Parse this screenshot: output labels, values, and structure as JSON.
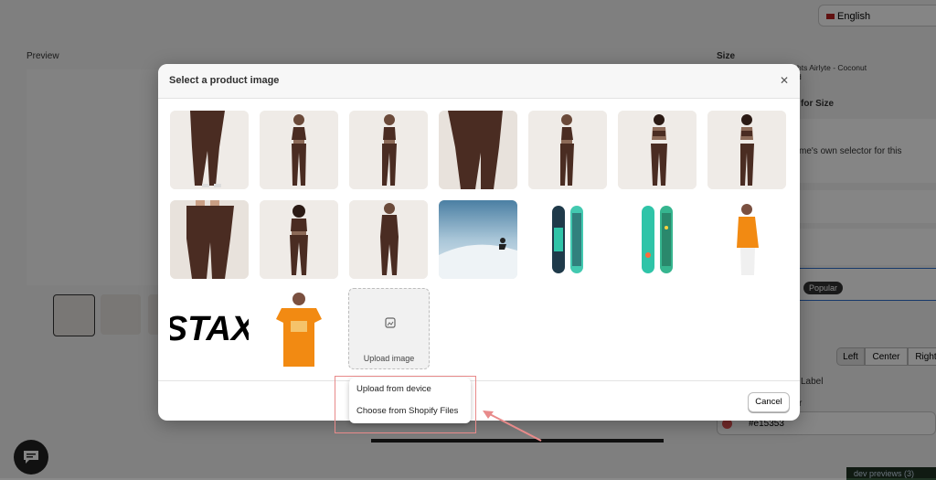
{
  "background": {
    "language": "English",
    "preview_label": "Preview",
    "size_label": "Size",
    "product_name": "hts Airlyte - Coconut",
    "product_name_line2": "d",
    "for_size": "for Size",
    "theme_text": "me's own selector for this",
    "popular_badge": "Popular",
    "align_options": [
      "Left",
      "Center",
      "Right"
    ],
    "label_text": "Label",
    "r_text": "r",
    "color_value": "#e15353",
    "dev_previews": "dev previews (3)"
  },
  "modal": {
    "title": "Select a product image",
    "upload_label": "Upload image",
    "cancel_label": "Cancel",
    "images": [
      {
        "name": "brown-leggings-front"
      },
      {
        "name": "brown-set-model-front"
      },
      {
        "name": "brown-set-model-pose"
      },
      {
        "name": "brown-leggings-closeup"
      },
      {
        "name": "brown-set-model-side"
      },
      {
        "name": "brown-set-model-back"
      },
      {
        "name": "brown-set-model-back-2"
      },
      {
        "name": "brown-leggings-back-closeup"
      },
      {
        "name": "brown-set-model-front-2"
      },
      {
        "name": "brown-bodysuit-model"
      },
      {
        "name": "snowboarder-photo"
      },
      {
        "name": "snowboard-teal"
      },
      {
        "name": "snowboard-green"
      },
      {
        "name": "orange-shirt-model-side"
      },
      {
        "name": "stax-logo",
        "text": "STAX"
      },
      {
        "name": "orange-shirt-model-front"
      }
    ]
  },
  "popover": {
    "items": [
      "Upload from device",
      "Choose from Shopify Files"
    ]
  },
  "colors": {
    "accent": "#e15353",
    "brown": "#4a2c22",
    "orange": "#f28a12",
    "teal": "#2fc4a8"
  }
}
